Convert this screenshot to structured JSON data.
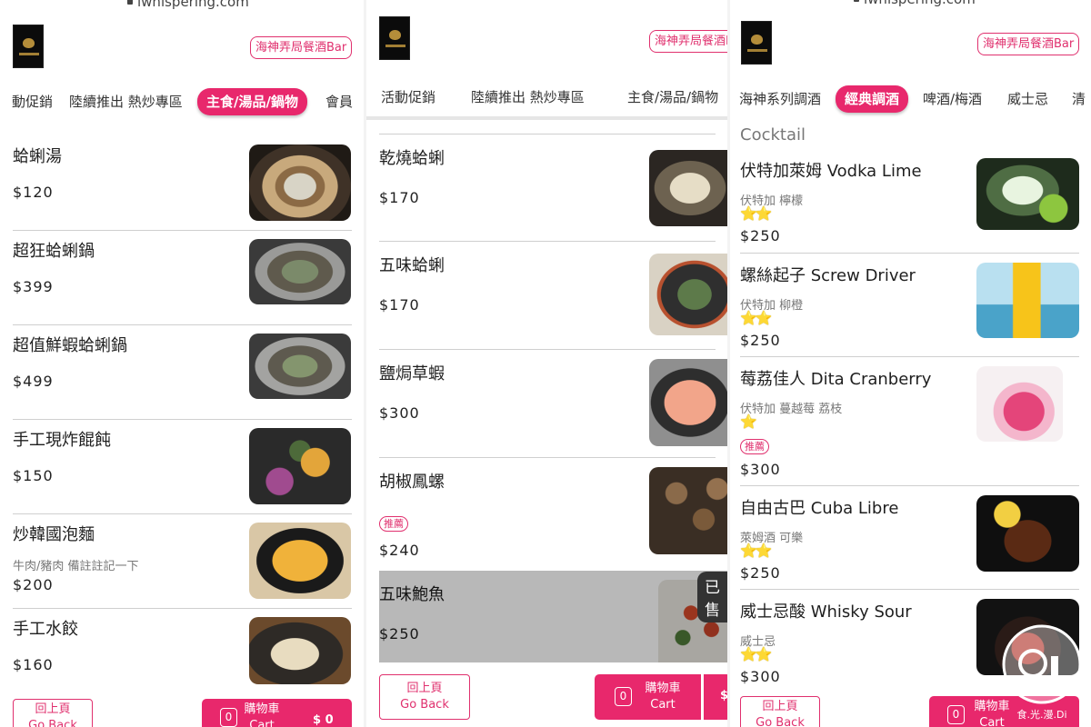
{
  "url": "iwhispering.com",
  "brand": "海神弄局餐酒Bar",
  "colors": {
    "accent": "#e8286c",
    "text": "#222222",
    "muted": "#777777",
    "star": "#f0c419"
  },
  "panel1": {
    "tabs": [
      "動促銷",
      "陸續推出 熱炒專區",
      "主食/湯品/鍋物",
      "會員"
    ],
    "items": [
      {
        "name": "蛤蜊湯",
        "price": "$120"
      },
      {
        "name": "超狂蛤蜊鍋",
        "price": "$399"
      },
      {
        "name": "超值鮮蝦蛤蜊鍋",
        "price": "$499"
      },
      {
        "name": "手工現炸餛飩",
        "price": "$150"
      },
      {
        "name": "炒韓國泡麵",
        "desc": "牛肉/豬肉 備註註記一下",
        "price": "$200"
      },
      {
        "name": "手工水餃",
        "price": "$160"
      }
    ],
    "back": {
      "zh": "回上頁",
      "en": "Go Back"
    },
    "cart": {
      "count": "0",
      "zh": "購物車",
      "en": "Cart",
      "total": "$ 0"
    }
  },
  "panel2": {
    "tabs": [
      "活動促銷",
      "陸續推出 熱炒專區",
      "主食/湯品/鍋物"
    ],
    "items": [
      {
        "name": "乾燒蛤蜊",
        "price": "$170"
      },
      {
        "name": "五味蛤蜊",
        "price": "$170"
      },
      {
        "name": "鹽焗草蝦",
        "price": "$300"
      },
      {
        "name": "胡椒鳳螺",
        "badge": "推薦",
        "price": "$240"
      },
      {
        "name": "五味鮑魚",
        "price": "$250",
        "sold_tag": "已售"
      }
    ],
    "back": {
      "zh": "回上頁",
      "en": "Go Back"
    },
    "cart": {
      "count": "0",
      "zh": "購物車",
      "en": "Cart",
      "total": "$"
    }
  },
  "panel3": {
    "tabs": [
      "海神系列調酒",
      "經典調酒",
      "啤酒/梅酒",
      "威士忌",
      "清"
    ],
    "section": "Cocktail",
    "items": [
      {
        "name": "伏特加萊姆 Vodka Lime",
        "desc": "伏特加 檸檬",
        "stars": "⭐⭐",
        "price": "$250"
      },
      {
        "name": "螺絲起子 Screw Driver",
        "desc": "伏特加 柳橙",
        "stars": "⭐⭐",
        "price": "$250"
      },
      {
        "name": "莓荔佳人 Dita Cranberry",
        "desc": "伏特加 蔓越莓 荔枝",
        "stars": "⭐",
        "badge": "推薦",
        "price": "$300"
      },
      {
        "name": "自由古巴 Cuba Libre",
        "desc": "萊姆酒 可樂",
        "stars": "⭐⭐",
        "price": "$250"
      },
      {
        "name": "威士忌酸 Whisky Sour",
        "desc": "威士忌",
        "stars": "⭐⭐",
        "price": "$300"
      }
    ],
    "back": {
      "zh": "回上頁",
      "en": "Go Back"
    },
    "cart": {
      "count": "0",
      "zh": "購物車",
      "en": "Cart"
    }
  },
  "watermark": "食.光.漫.Di"
}
